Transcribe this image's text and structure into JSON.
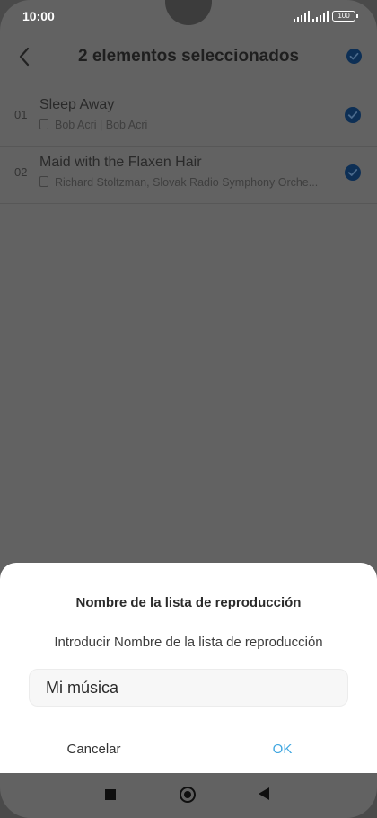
{
  "status_bar": {
    "time": "10:00",
    "battery": "100",
    "icons": [
      "signal-icon",
      "signal-icon",
      "battery-icon"
    ]
  },
  "header": {
    "title": "2 elementos seleccionados",
    "back_icon": "chevron-left-icon",
    "select_all_icon": "check-circle-icon"
  },
  "songs": [
    {
      "number": "01",
      "title": "Sleep Away",
      "artist": "Bob Acri | Bob Acri",
      "checked": true
    },
    {
      "number": "02",
      "title": "Maid with the Flaxen Hair",
      "artist": "Richard Stoltzman, Slovak Radio Symphony Orche...",
      "checked": true
    }
  ],
  "dialog": {
    "title": "Nombre de la lista de reproducción",
    "prompt": "Introducir Nombre de la lista de reproducción",
    "input_value": "Mi música",
    "cancel_label": "Cancelar",
    "ok_label": "OK"
  },
  "navbar": {
    "icons": [
      "recents-icon",
      "home-icon",
      "back-icon"
    ]
  },
  "colors": {
    "accent": "#3fa6e0",
    "check_selected": "#0d2f55",
    "dim_overlay": "#626262"
  }
}
